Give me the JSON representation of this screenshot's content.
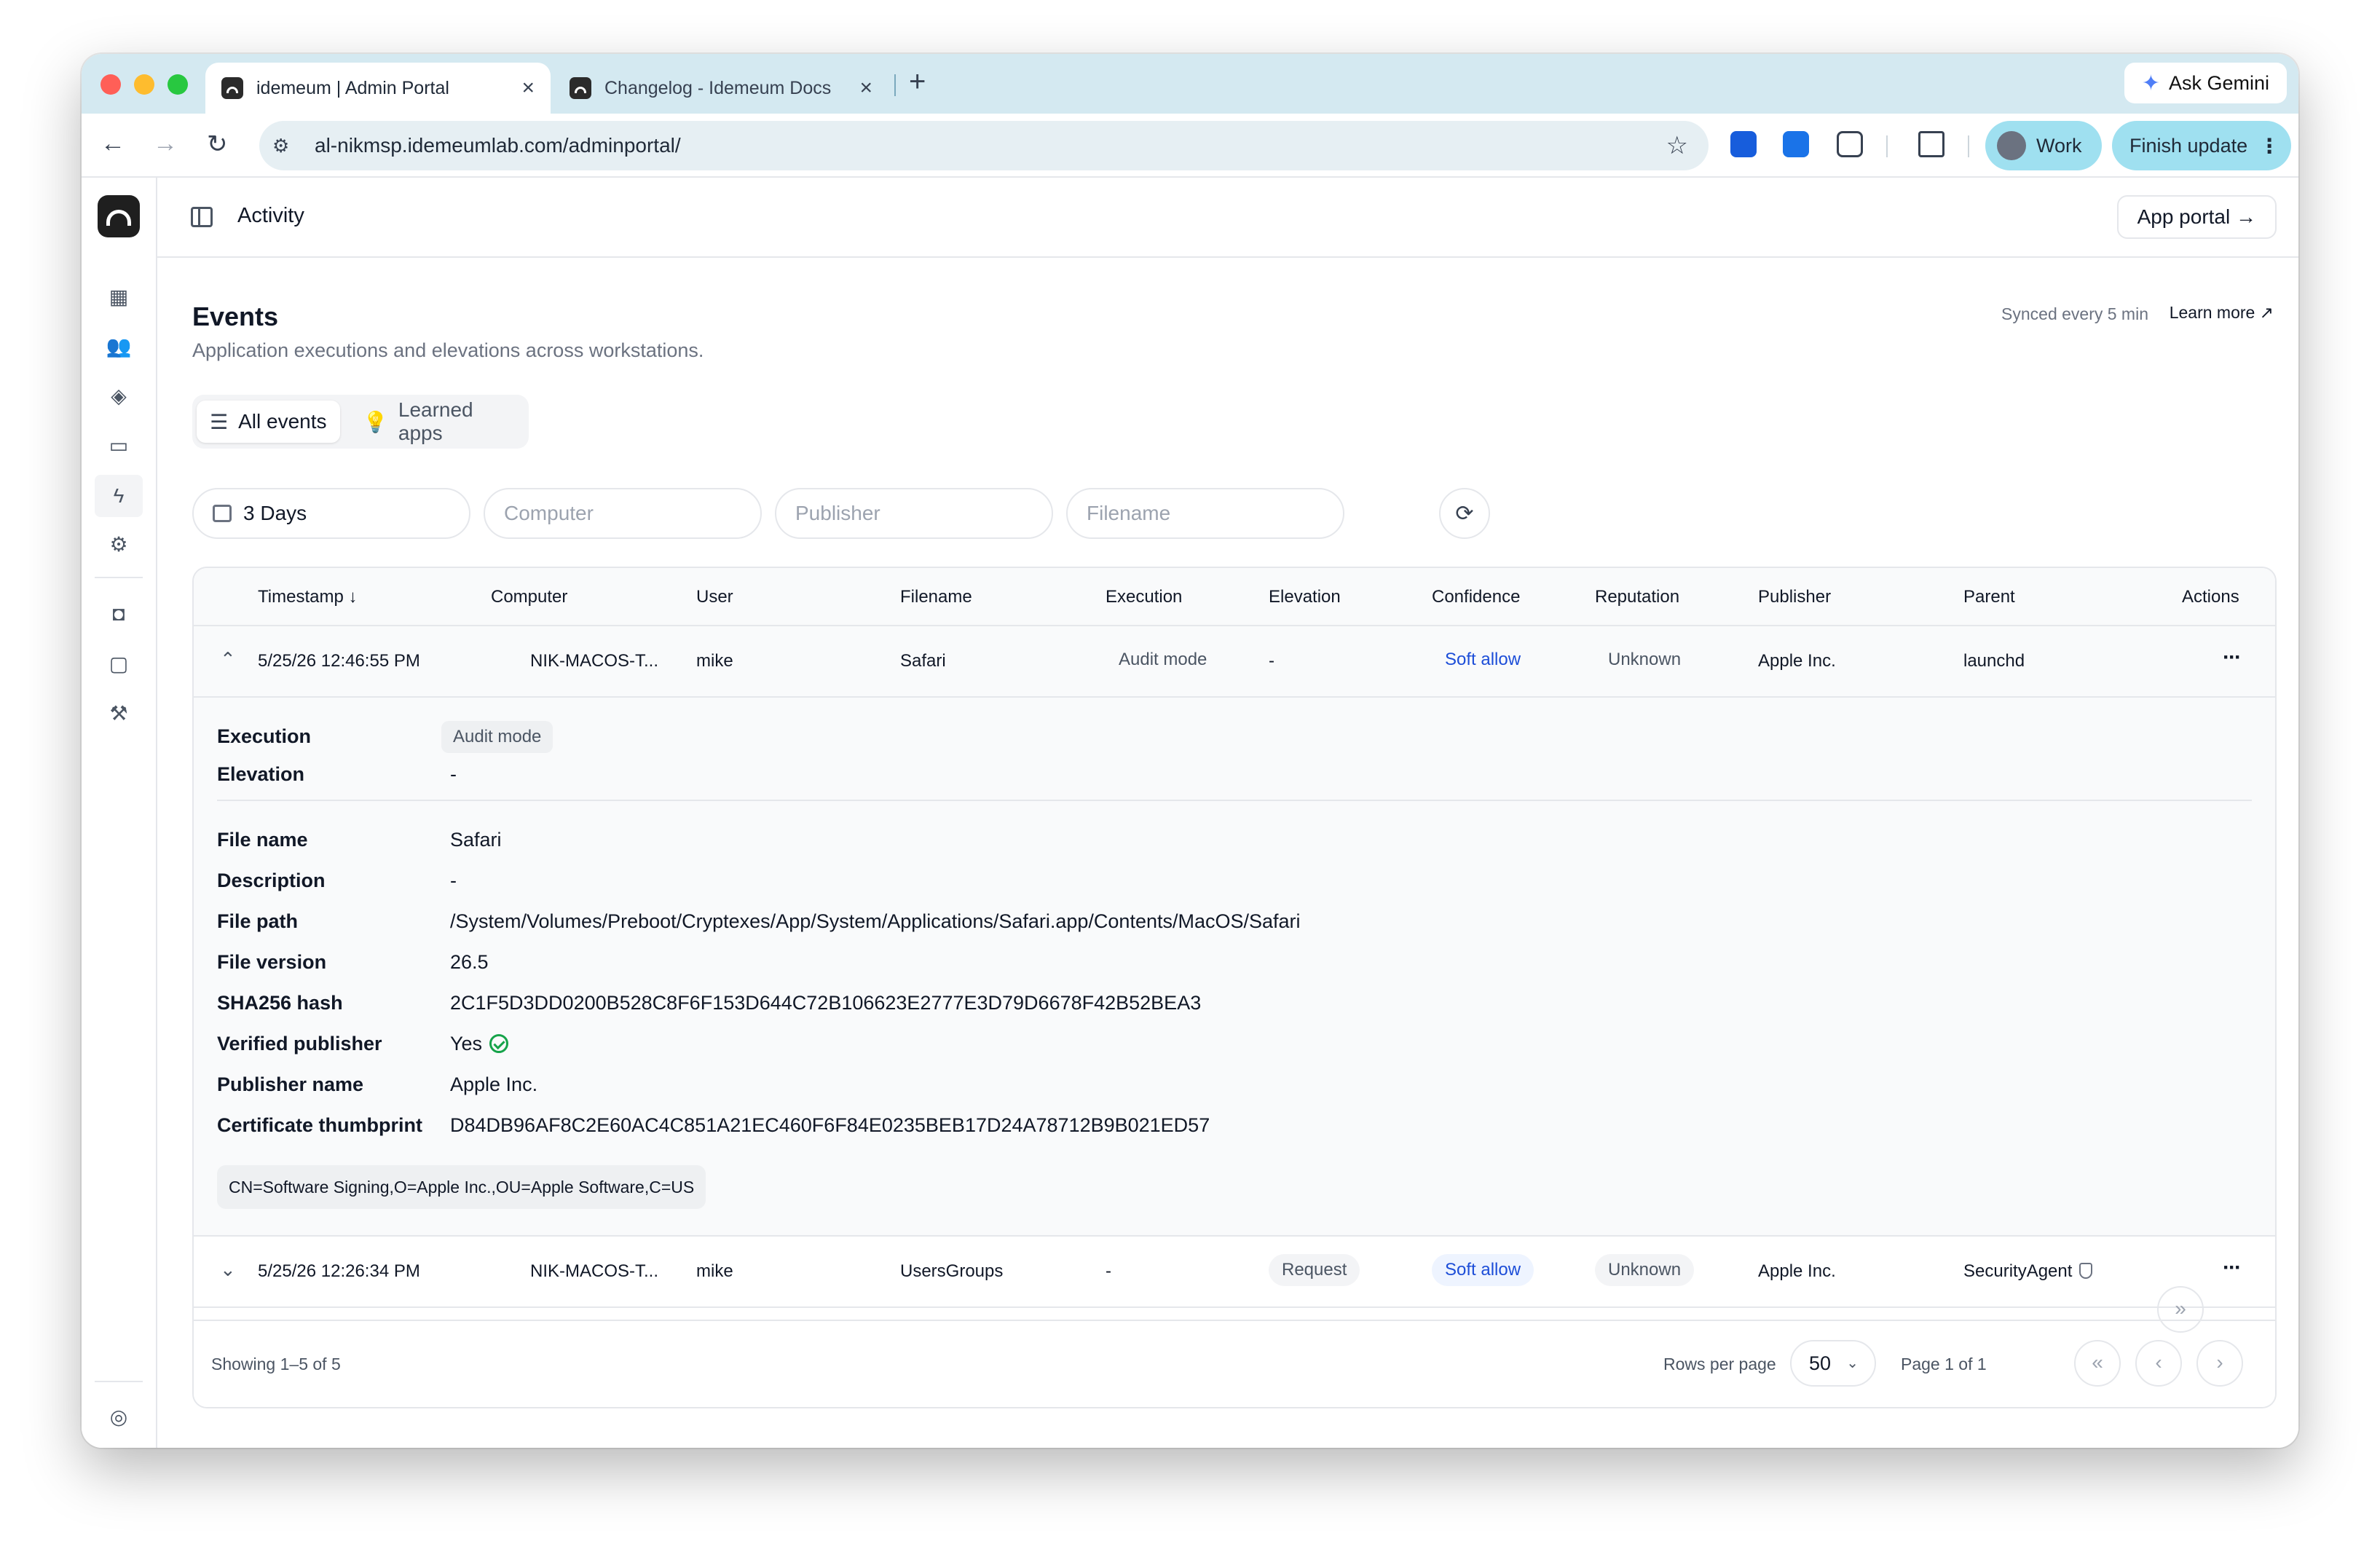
{
  "browser": {
    "tabs": [
      {
        "title": "idemeum | Admin Portal",
        "close": "×"
      },
      {
        "title": "Changelog - Idemeum Docs",
        "close": "×"
      }
    ],
    "new_tab": "+",
    "ask_gemini": "Ask Gemini",
    "url": "al-nikmsp.idemeumlab.com/adminportal/",
    "profile": "Work",
    "finish_update": "Finish update"
  },
  "topbar": {
    "breadcrumb": "Activity",
    "app_portal": "App portal →"
  },
  "header": {
    "title": "Events",
    "subtitle": "Application executions and elevations across workstations.",
    "synced": "Synced every 5 min",
    "learn_more": "Learn more ↗"
  },
  "segments": {
    "all_events": "All events",
    "learned_apps": "Learned apps"
  },
  "filters": {
    "date": "3 Days",
    "computer_placeholder": "Computer",
    "publisher_placeholder": "Publisher",
    "filename_placeholder": "Filename"
  },
  "table": {
    "columns": [
      "Timestamp ↓",
      "Computer",
      "User",
      "Filename",
      "Execution",
      "Elevation",
      "Confidence",
      "Reputation",
      "Publisher",
      "Parent",
      "Actions"
    ],
    "rows": [
      {
        "timestamp": "5/25/26 12:46:55 PM",
        "computer": "NIK-MACOS-T...",
        "user": "mike",
        "filename": "Safari",
        "execution": "Audit mode",
        "elevation": "-",
        "confidence": "Soft allow",
        "reputation": "Unknown",
        "publisher": "Apple Inc.",
        "parent": "launchd",
        "actions": "···"
      },
      {
        "timestamp": "5/25/26 12:26:34 PM",
        "computer": "NIK-MACOS-T...",
        "user": "mike",
        "filename": "UsersGroups",
        "execution": "-",
        "elevation": "Request",
        "confidence": "Soft allow",
        "reputation": "Unknown",
        "publisher": "Apple Inc.",
        "parent": "SecurityAgent",
        "actions": "···"
      }
    ],
    "details": {
      "execution_label": "Execution",
      "execution_value": "Audit mode",
      "elevation_label": "Elevation",
      "elevation_value": "-",
      "file_name_label": "File name",
      "file_name_value": "Safari",
      "description_label": "Description",
      "description_value": "-",
      "file_path_label": "File path",
      "file_path_value": "/System/Volumes/Preboot/Cryptexes/App/System/Applications/Safari.app/Contents/MacOS/Safari",
      "file_version_label": "File version",
      "file_version_value": "26.5",
      "sha_label": "SHA256 hash",
      "sha_value": "2C1F5D3DD0200B528C8F6F153D644C72B106623E2777E3D79D6678F42B52BEA3",
      "verified_label": "Verified publisher",
      "verified_value": "Yes",
      "publisher_name_label": "Publisher name",
      "publisher_name_value": "Apple Inc.",
      "thumbprint_label": "Certificate thumbprint",
      "thumbprint_value": "D84DB96AF8C2E60AC4C851A21EC460F6F84E0235BEB17D24A78712B9B021ED57",
      "subject": "CN=Software Signing,O=Apple Inc.,OU=Apple Software,C=US"
    },
    "footer": {
      "showing": "Showing 1–5 of 5",
      "rows_per_page_label": "Rows per page",
      "rows_per_page_value": "50",
      "page_of": "Page 1 of 1"
    }
  },
  "colors": {
    "tabstrip": "#d4e9f1",
    "accent_pill": "#9fe0f0",
    "soft_allow_text": "#1d4ed8",
    "verified_check": "#16a34a"
  }
}
